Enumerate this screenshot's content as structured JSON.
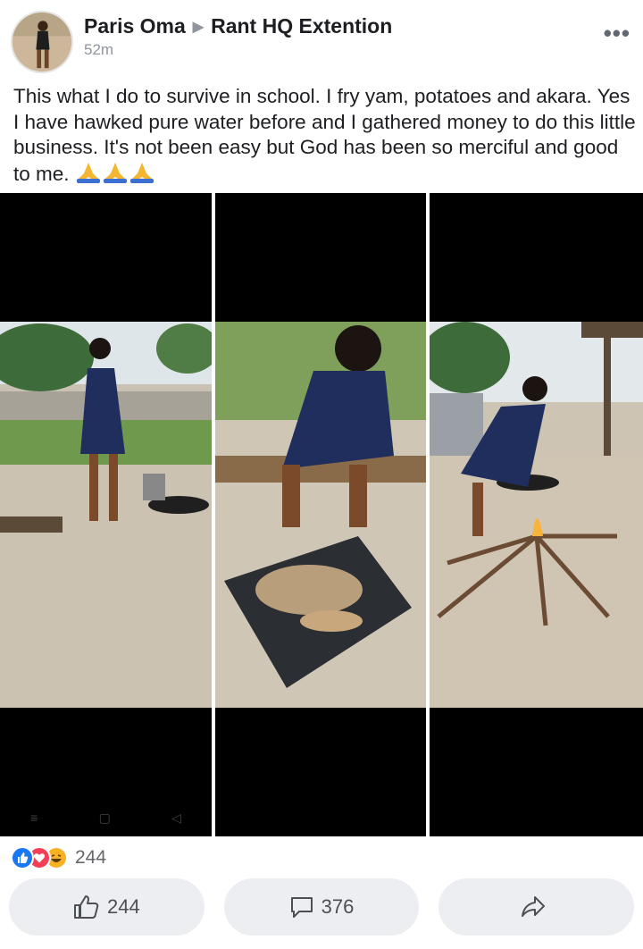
{
  "post": {
    "author": "Paris Oma",
    "group": "Rant HQ Extention",
    "time": "52m",
    "text": "This what I do to survive in school. I fry yam, potatoes and akara. Yes I have hawked pure water before and I gathered money to do this little business. It's not been easy but God has been so merciful and good to me.",
    "emoji": [
      "praying-hands",
      "praying-hands",
      "praying-hands"
    ]
  },
  "photos": [
    {
      "icon": "photo-woman-standing-by-frying-pan"
    },
    {
      "icon": "photo-woman-peeling-yam"
    },
    {
      "icon": "photo-woman-at-firewood-stove"
    }
  ],
  "navbar": {
    "menu": "≡",
    "home": "▢",
    "back": "◁"
  },
  "reactions": {
    "icons": [
      "like-icon",
      "love-icon",
      "haha-icon"
    ],
    "count": "244"
  },
  "actions": {
    "like_count": "244",
    "comment_count": "376"
  },
  "colors": {
    "like": "#1877f2",
    "love": "#f33e58",
    "haha": "#f7b125",
    "button_bg": "#eceef1"
  }
}
